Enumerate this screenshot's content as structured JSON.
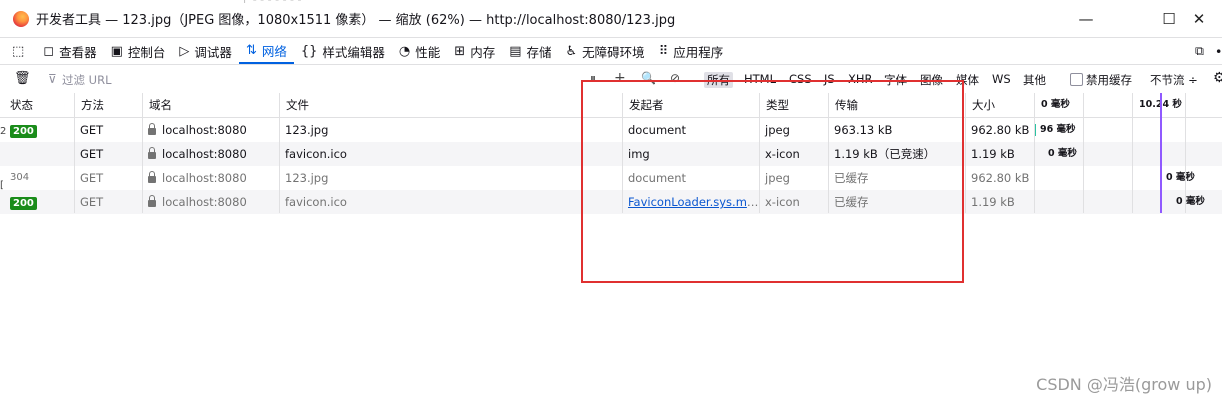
{
  "window": {
    "title": "开发者工具 — 123.jpg（JPEG 图像，1080x1511 像素） — 缩放 (62%) — http://localhost:8080/123.jpg",
    "minimize": "—",
    "maximize": "☐",
    "close": "✕"
  },
  "toolbar": {
    "items": [
      {
        "label": "查看器",
        "icon": "inspector-icon"
      },
      {
        "label": "控制台",
        "icon": "console-icon"
      },
      {
        "label": "调试器",
        "icon": "debugger-icon"
      },
      {
        "label": "网络",
        "icon": "network-icon"
      },
      {
        "label": "样式编辑器",
        "icon": "style-editor-icon"
      },
      {
        "label": "性能",
        "icon": "performance-icon"
      },
      {
        "label": "内存",
        "icon": "memory-icon"
      },
      {
        "label": "存储",
        "icon": "storage-icon"
      },
      {
        "label": "无障碍环境",
        "icon": "accessibility-icon"
      },
      {
        "label": "应用程序",
        "icon": "application-icon"
      }
    ],
    "active": "网络"
  },
  "filter": {
    "placeholder": "过滤 URL",
    "types": [
      "所有",
      "HTML",
      "CSS",
      "JS",
      "XHR",
      "字体",
      "图像",
      "媒体",
      "WS",
      "其他"
    ],
    "selected": "所有",
    "disable_cache": "禁用缓存",
    "throttle": "不节流 ÷"
  },
  "table": {
    "headers": [
      "状态",
      "方法",
      "域名",
      "文件",
      "发起者",
      "类型",
      "传输",
      "大小",
      "0 毫秒",
      "10.24 秒"
    ],
    "rows": [
      {
        "status": "200",
        "method": "GET",
        "domain": "localhost:8080",
        "file": "123.jpg",
        "initiator": "document",
        "type": "jpeg",
        "transfer": "963.13 kB",
        "size": "962.80 kB",
        "timing": "96 毫秒"
      },
      {
        "status": "",
        "method": "GET",
        "domain": "localhost:8080",
        "file": "favicon.ico",
        "initiator": "img",
        "type": "x-icon",
        "transfer": "1.19 kB（已竞速）",
        "size": "1.19 kB",
        "timing": "0 毫秒"
      },
      {
        "status": "304",
        "method": "GET",
        "domain": "localhost:8080",
        "file": "123.jpg",
        "initiator": "document",
        "type": "jpeg",
        "transfer": "已缓存",
        "size": "962.80 kB",
        "timing": "0 毫秒"
      },
      {
        "status": "200",
        "method": "GET",
        "domain": "localhost:8080",
        "file": "favicon.ico",
        "initiator": "FaviconLoader.sys.mjs:...",
        "type": "x-icon",
        "transfer": "已缓存",
        "size": "1.19 kB",
        "timing": "0 毫秒"
      }
    ]
  },
  "watermark": "CSDN @冯浩(grow up)",
  "colors": {
    "accent": "#0061e0",
    "status_ok": "#1a8c1a",
    "highlight_box": "#e03030"
  }
}
